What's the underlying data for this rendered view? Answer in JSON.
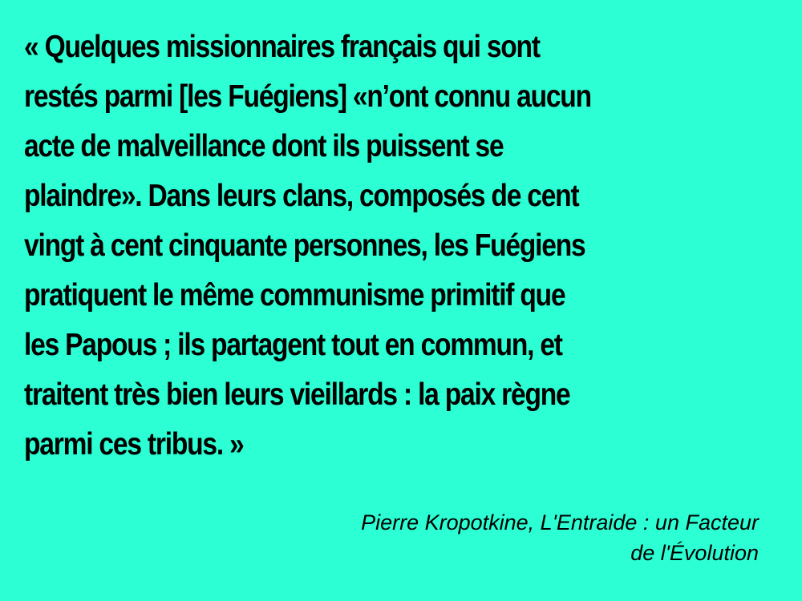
{
  "quote": {
    "lines": [
      "« Quelques missionnaires français qui sont",
      "restés parmi [les Fuégiens] «n’ont connu aucun",
      "acte de malveillance dont ils puissent se",
      "plaindre». Dans leurs clans, composés de cent",
      "vingt à cent cinquante personnes, les Fuégiens",
      "pratiquent le même communisme primitif que",
      "les Papous ; ils partagent tout en commun, et",
      "traitent très bien leurs vieillards : la paix règne",
      "parmi ces tribus. »"
    ]
  },
  "attribution": {
    "lines": [
      "Pierre Kropotkine, L'Entraide : un Facteur",
      "de l'Évolution"
    ]
  },
  "colors": {
    "background": "#2bffd3",
    "text": "#000000"
  }
}
